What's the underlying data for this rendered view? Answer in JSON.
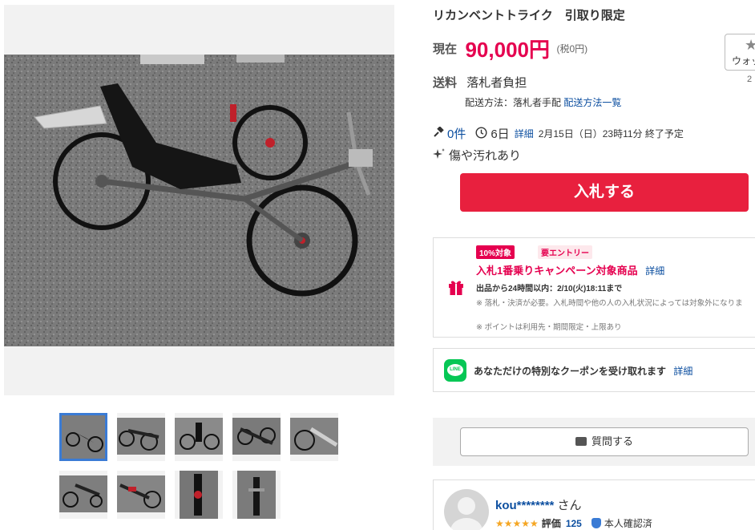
{
  "item": {
    "title": "リカンベントトライク　引取り限定",
    "price_label": "現在",
    "price_value": "90,000円",
    "price_tax": "(税0円)",
    "watch_label": "ウォッ",
    "watch_count": "2",
    "shipping_label": "送料",
    "shipping_value": "落札者負担",
    "shipping_method": "配送方法：落札者手配",
    "shipping_list_link": "配送方法一覧",
    "bids": "0件",
    "time_left": "6日",
    "detail_link": "詳細",
    "end_time": "2月15日（日）23時11分 終了予定",
    "condition": "傷や汚れあり",
    "bid_button": "入札する"
  },
  "campaign": {
    "badge_points": "10%対象",
    "badge_entry": "要エントリー",
    "title": "入札1番乗りキャンペーン対象商品",
    "detail_link": "詳細",
    "deadline": "出品から24時間以内：2/10(火)18:11まで",
    "note1": "※ 落札・決済が必要。入札時間や他の人の入札状況によっては対象外になりま",
    "note2": "※ ポイントは利用先・期間限定・上限あり"
  },
  "coupon": {
    "icon_text": "LINE",
    "text": "あなただけの特別なクーポンを受け取れます",
    "detail_link": "詳細"
  },
  "qa": {
    "button": "質問する"
  },
  "seller": {
    "name": "kou********",
    "suffix": "さん",
    "stars": "★★★★★",
    "rating_label": "評価",
    "rating_count": "125",
    "verified": "本人確認済"
  },
  "gallery": {
    "thumbnail_count": 9,
    "selected_index": 0
  },
  "colors": {
    "price": "#e5004f",
    "bid_button": "#e8203e",
    "link": "#0d4fa0",
    "line_green": "#06c755",
    "thumb_selected": "#3a7bd5"
  }
}
